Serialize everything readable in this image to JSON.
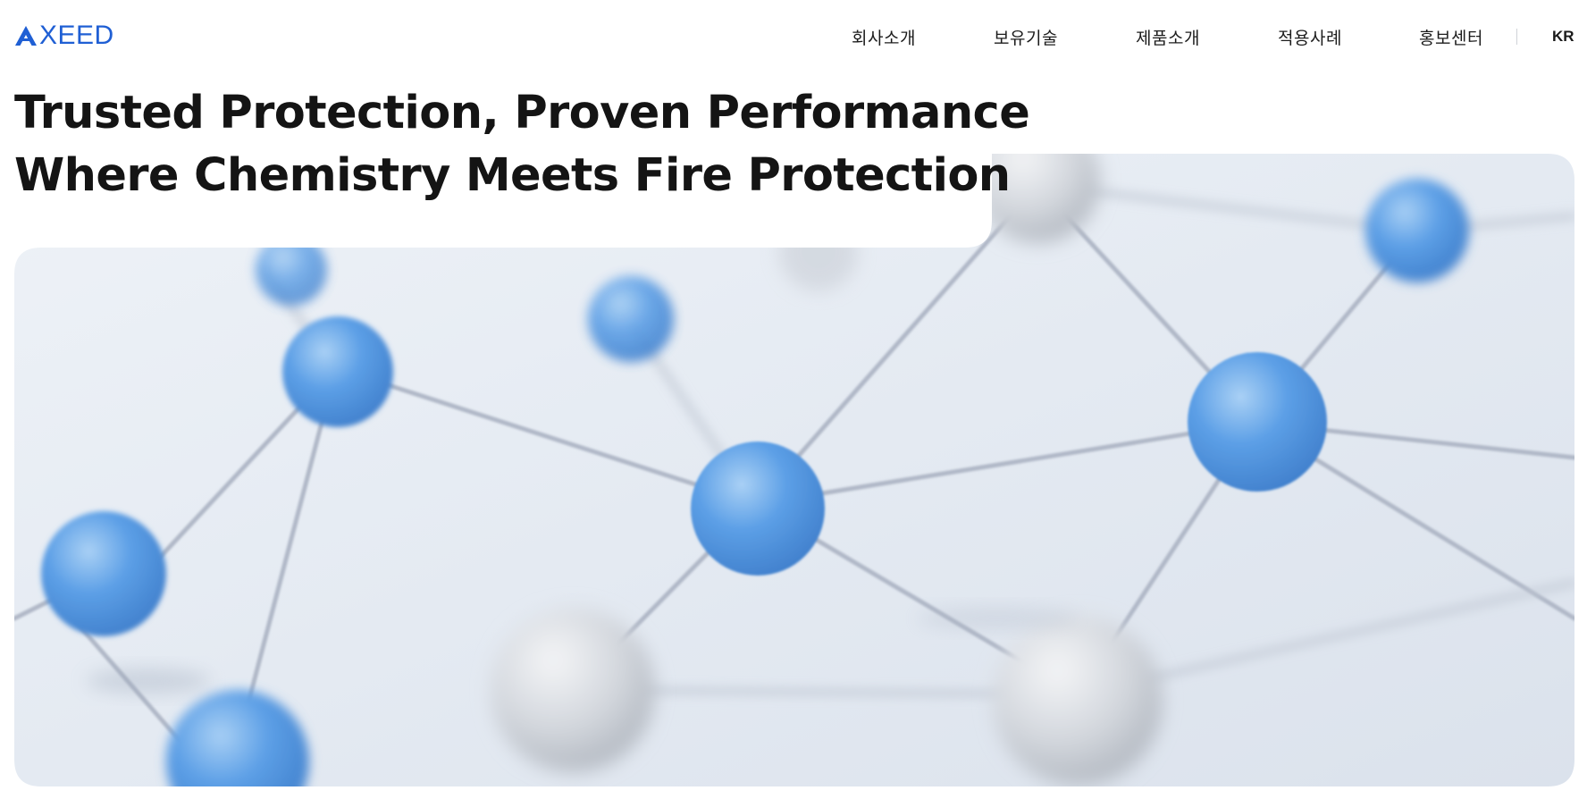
{
  "brand": {
    "logo_text": "XEED",
    "logo_icon": "axeed-a-mark-icon",
    "color": "#1f5fd4"
  },
  "nav": {
    "items": [
      {
        "label": "회사소개"
      },
      {
        "label": "보유기술"
      },
      {
        "label": "제품소개"
      },
      {
        "label": "적용사례"
      },
      {
        "label": "홍보센터"
      }
    ],
    "language": "KR"
  },
  "hero": {
    "headline_line1": "Trusted Protection, Proven Performance",
    "headline_line2": "Where Chemistry Meets Fire Protection",
    "image": "molecular-network-illustration",
    "colors": {
      "background": "#e3e9f1",
      "node_blue": "#5a9fe3",
      "node_gray": "#d2d6dc",
      "bond": "#b4bccb"
    }
  }
}
